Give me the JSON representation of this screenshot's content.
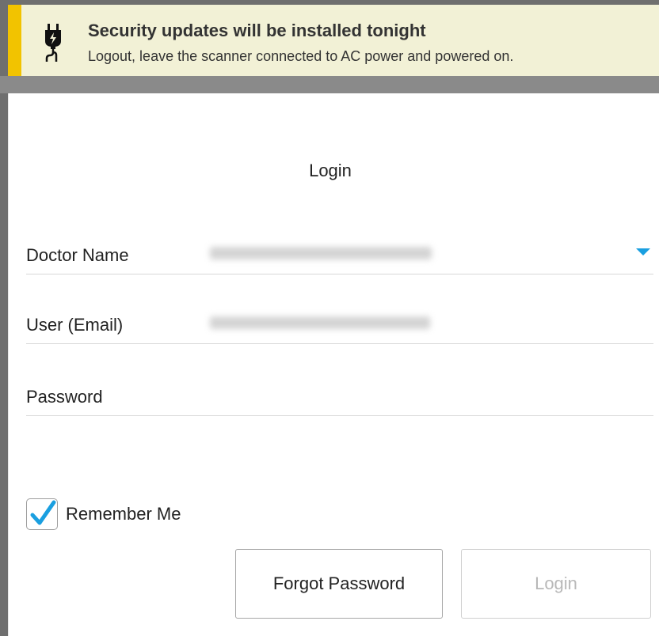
{
  "banner": {
    "title": "Security updates will be installed tonight",
    "message": "Logout, leave the scanner connected to AC power and powered on.",
    "icon": "power-plug-icon",
    "accent_color": "#f2c300",
    "background_color": "#f2f1d6"
  },
  "login": {
    "title": "Login",
    "fields": {
      "doctor_name": {
        "label": "Doctor Name",
        "value": "",
        "blurred": true
      },
      "user_email": {
        "label": "User (Email)",
        "value": "",
        "blurred": true
      },
      "password": {
        "label": "Password",
        "value": ""
      }
    },
    "remember_me": {
      "label": "Remember Me",
      "checked": true
    },
    "buttons": {
      "forgot_password": "Forgot Password",
      "login": "Login"
    },
    "accent_color": "#1a9fe0"
  }
}
